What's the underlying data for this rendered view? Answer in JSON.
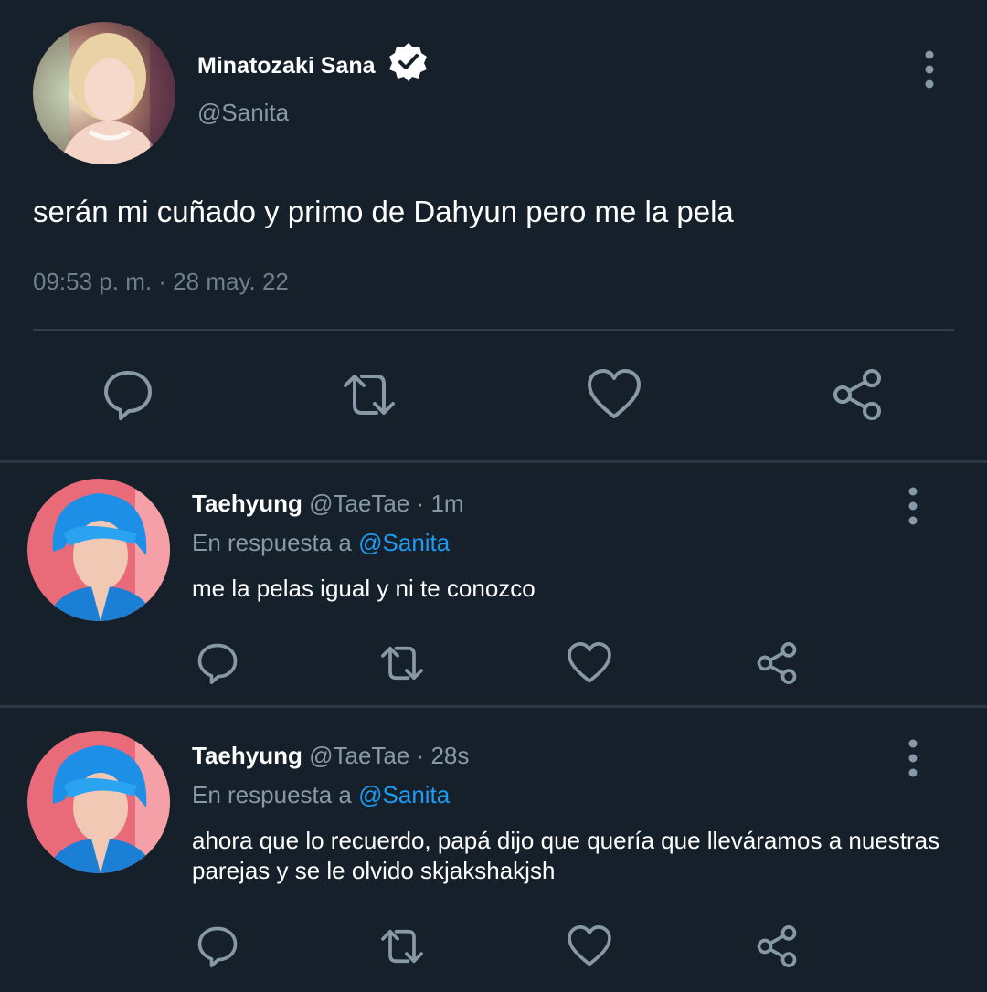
{
  "main_tweet": {
    "author_name": "Minatozaki Sana",
    "handle": "@Sanita",
    "text": "serán mi cuñado y primo de Dahyun pero me la pela",
    "timestamp": "09:53 p. m. · 28 may. 22",
    "avatar_icon": "profile-photo",
    "verified_icon": "verified-badge-icon"
  },
  "replies": [
    {
      "author_name": "Taehyung",
      "handle": "@TaeTae",
      "time": "1m",
      "reply_prefix": "En respuesta a",
      "reply_to": "@Sanita",
      "text": "me la pelas igual y ni te conozco"
    },
    {
      "author_name": "Taehyung",
      "handle": "@TaeTae",
      "time": "28s",
      "reply_prefix": "En respuesta a",
      "reply_to": "@Sanita",
      "text": "ahora que lo recuerdo, papá dijo que quería que lleváramos a nuestras parejas y se le olvido skjakshakjsh"
    }
  ],
  "actions": [
    "reply-icon",
    "retweet-icon",
    "like-icon",
    "share-icon"
  ],
  "colors": {
    "background": "#15202b",
    "secondary_text": "#8899a6",
    "link": "#1d9bf0",
    "icon": "#8899a6"
  }
}
